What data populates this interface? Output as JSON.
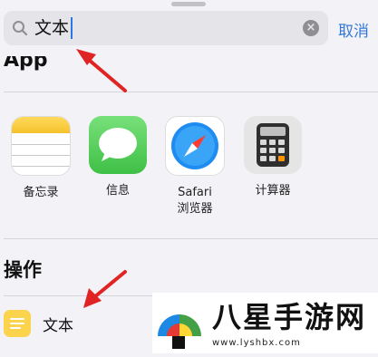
{
  "search": {
    "query": "文本",
    "cancel_label": "取消"
  },
  "sections": {
    "apps_title": "App",
    "actions_title": "操作"
  },
  "apps": [
    {
      "label": "备忘录",
      "icon": "notes-icon"
    },
    {
      "label": "信息",
      "icon": "messages-icon"
    },
    {
      "label": "Safari\n浏览器",
      "icon": "safari-icon"
    },
    {
      "label": "计算器",
      "icon": "calculator-icon"
    }
  ],
  "actions": [
    {
      "label": "文本",
      "icon": "text-action-icon"
    }
  ],
  "watermark": {
    "text": "八星手游网",
    "url": "www.lyshbx.com"
  },
  "colors": {
    "accent": "#3478d6",
    "arrow": "#e02424",
    "action_icon": "#fbd34d"
  }
}
